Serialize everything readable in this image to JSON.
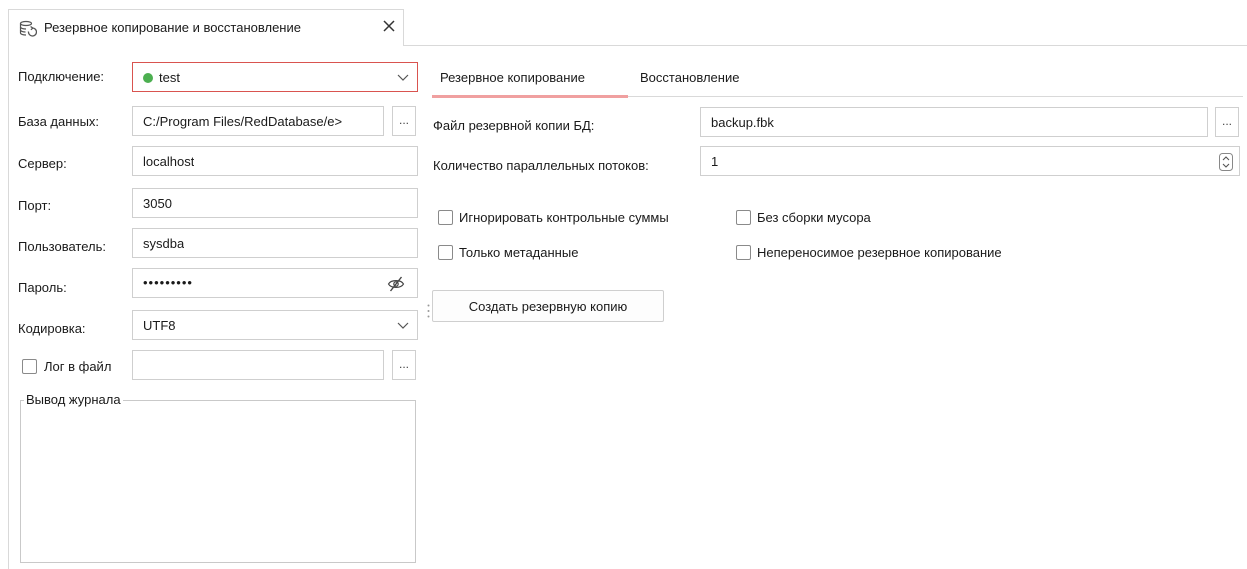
{
  "tab": {
    "title": "Резервное копирование и восстановление",
    "icon": "database-refresh-icon",
    "close_icon": "close-icon"
  },
  "form": {
    "connection": {
      "label": "Подключение:",
      "value": "test",
      "status_color": "#4caf50"
    },
    "database": {
      "label": "База данных:",
      "value": "C:/Program Files/RedDatabase/e>",
      "browse": "..."
    },
    "server": {
      "label": "Сервер:",
      "value": "localhost"
    },
    "port": {
      "label": "Порт:",
      "value": "3050"
    },
    "user": {
      "label": "Пользователь:",
      "value": "sysdba"
    },
    "password": {
      "label": "Пароль:",
      "value": "•••••••••",
      "toggle_icon": "eye-slash-icon"
    },
    "encoding": {
      "label": "Кодировка:",
      "value": "UTF8"
    },
    "log_to_file": {
      "label": "Лог в файл",
      "checked": false,
      "value": "",
      "browse": "..."
    },
    "log_output": {
      "title": "Вывод журнала"
    }
  },
  "right": {
    "tabs": [
      {
        "label": "Резервное копирование",
        "active": true
      },
      {
        "label": "Восстановление",
        "active": false
      }
    ],
    "backup_file": {
      "label": "Файл резервной копии БД:",
      "value": "backup.fbk",
      "browse": "..."
    },
    "threads": {
      "label": "Количество параллельных потоков:",
      "value": "1"
    },
    "options": {
      "ignore_checksums": {
        "label": "Игнорировать контрольные суммы",
        "checked": false
      },
      "no_garbage": {
        "label": "Без сборки мусора",
        "checked": false
      },
      "metadata_only": {
        "label": "Только метаданные",
        "checked": false
      },
      "non_transportable": {
        "label": "Непереносимое резервное копирование",
        "checked": false
      }
    },
    "create_button": "Создать резервную копию"
  },
  "colors": {
    "accent": "#d9534f",
    "tab_underline": "#f0a0a0"
  }
}
